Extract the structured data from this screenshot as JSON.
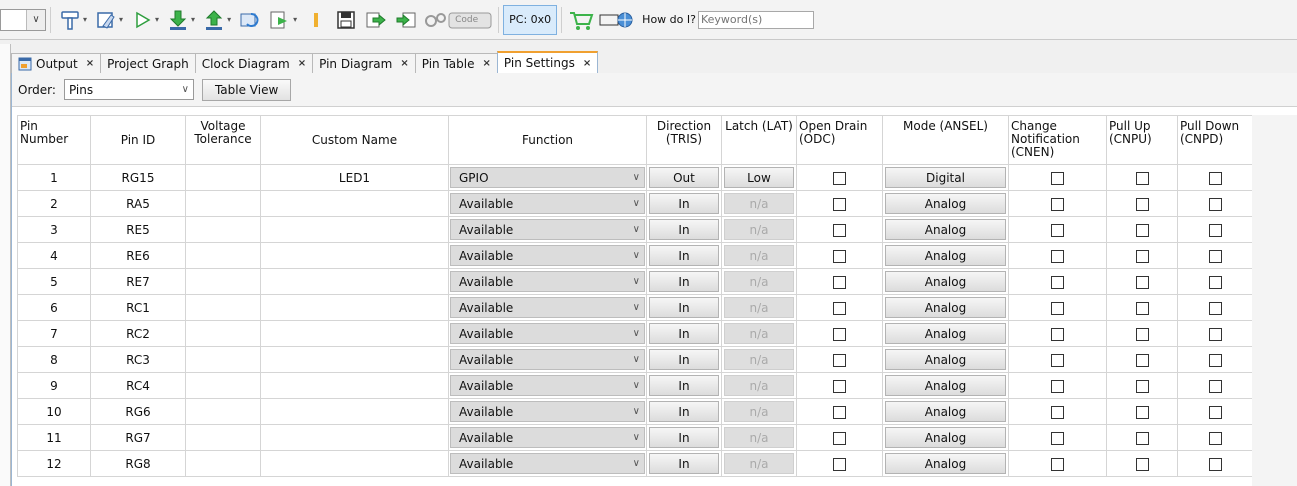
{
  "toolbar": {
    "pc_label": "PC: 0x0",
    "howdo_label": "How do I?",
    "keyword_placeholder": "Keyword(s)",
    "code_label": "Code"
  },
  "tabs": [
    {
      "label": "Output",
      "closable": true,
      "active": false
    },
    {
      "label": "Project Graph",
      "closable": false,
      "active": false
    },
    {
      "label": "Clock Diagram",
      "closable": true,
      "active": false
    },
    {
      "label": "Pin Diagram",
      "closable": true,
      "active": false
    },
    {
      "label": "Pin Table",
      "closable": true,
      "active": false
    },
    {
      "label": "Pin Settings",
      "closable": true,
      "active": true
    }
  ],
  "order": {
    "label": "Order:",
    "value": "Pins",
    "table_view_label": "Table View"
  },
  "columns": [
    "Pin Number",
    "Pin ID",
    "Voltage Tolerance",
    "Custom Name",
    "Function",
    "Direction (TRIS)",
    "Latch (LAT)",
    "Open Drain (ODC)",
    "Mode (ANSEL)",
    "Change Notification (CNEN)",
    "Pull Up (CNPU)",
    "Pull Down (CNPD)"
  ],
  "rows": [
    {
      "num": "1",
      "id": "RG15",
      "custom": "LED1",
      "function": "GPIO",
      "direction": "Out",
      "latch": "Low",
      "latch_enabled": true,
      "mode": "Digital"
    },
    {
      "num": "2",
      "id": "RA5",
      "custom": "",
      "function": "Available",
      "direction": "In",
      "latch": "n/a",
      "latch_enabled": false,
      "mode": "Analog"
    },
    {
      "num": "3",
      "id": "RE5",
      "custom": "",
      "function": "Available",
      "direction": "In",
      "latch": "n/a",
      "latch_enabled": false,
      "mode": "Analog"
    },
    {
      "num": "4",
      "id": "RE6",
      "custom": "",
      "function": "Available",
      "direction": "In",
      "latch": "n/a",
      "latch_enabled": false,
      "mode": "Analog"
    },
    {
      "num": "5",
      "id": "RE7",
      "custom": "",
      "function": "Available",
      "direction": "In",
      "latch": "n/a",
      "latch_enabled": false,
      "mode": "Analog"
    },
    {
      "num": "6",
      "id": "RC1",
      "custom": "",
      "function": "Available",
      "direction": "In",
      "latch": "n/a",
      "latch_enabled": false,
      "mode": "Analog"
    },
    {
      "num": "7",
      "id": "RC2",
      "custom": "",
      "function": "Available",
      "direction": "In",
      "latch": "n/a",
      "latch_enabled": false,
      "mode": "Analog"
    },
    {
      "num": "8",
      "id": "RC3",
      "custom": "",
      "function": "Available",
      "direction": "In",
      "latch": "n/a",
      "latch_enabled": false,
      "mode": "Analog"
    },
    {
      "num": "9",
      "id": "RC4",
      "custom": "",
      "function": "Available",
      "direction": "In",
      "latch": "n/a",
      "latch_enabled": false,
      "mode": "Analog"
    },
    {
      "num": "10",
      "id": "RG6",
      "custom": "",
      "function": "Available",
      "direction": "In",
      "latch": "n/a",
      "latch_enabled": false,
      "mode": "Analog"
    },
    {
      "num": "11",
      "id": "RG7",
      "custom": "",
      "function": "Available",
      "direction": "In",
      "latch": "n/a",
      "latch_enabled": false,
      "mode": "Analog"
    },
    {
      "num": "12",
      "id": "RG8",
      "custom": "",
      "function": "Available",
      "direction": "In",
      "latch": "n/a",
      "latch_enabled": false,
      "mode": "Analog"
    }
  ]
}
